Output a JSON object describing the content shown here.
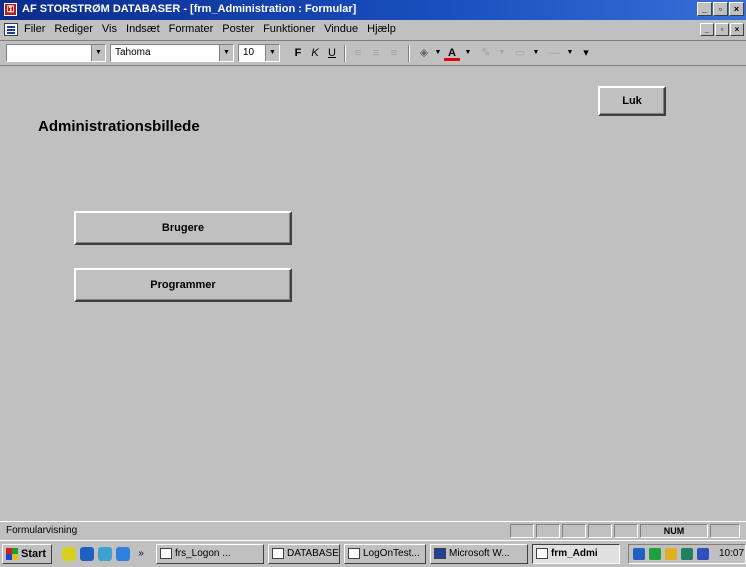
{
  "window": {
    "title": "AF STORSTRØM DATABASER - [frm_Administration : Formular]"
  },
  "menu": {
    "items": [
      "Filer",
      "Rediger",
      "Vis",
      "Indsæt",
      "Formater",
      "Poster",
      "Funktioner",
      "Vindue",
      "Hjælp"
    ]
  },
  "toolbar": {
    "object_combo": "",
    "font_combo": "Tahoma",
    "size_combo": "10",
    "bold": "F",
    "italic": "K",
    "underline": "U"
  },
  "form": {
    "title": "Administrationsbillede",
    "close_label": "Luk",
    "users_label": "Brugere",
    "programs_label": "Programmer"
  },
  "status": {
    "text": "Formularvisning",
    "num": "NUM"
  },
  "taskbar": {
    "start_label": "Start",
    "tasks": [
      "frs_Logon ...",
      "DATABASER",
      "LogOnTest...",
      "Microsoft W...",
      "frm_Admi"
    ],
    "clock": "10:07"
  },
  "colors": {
    "title_bar": "#0a2c8c",
    "face": "#c0c0c0",
    "font_color_underline": "#e00000"
  }
}
